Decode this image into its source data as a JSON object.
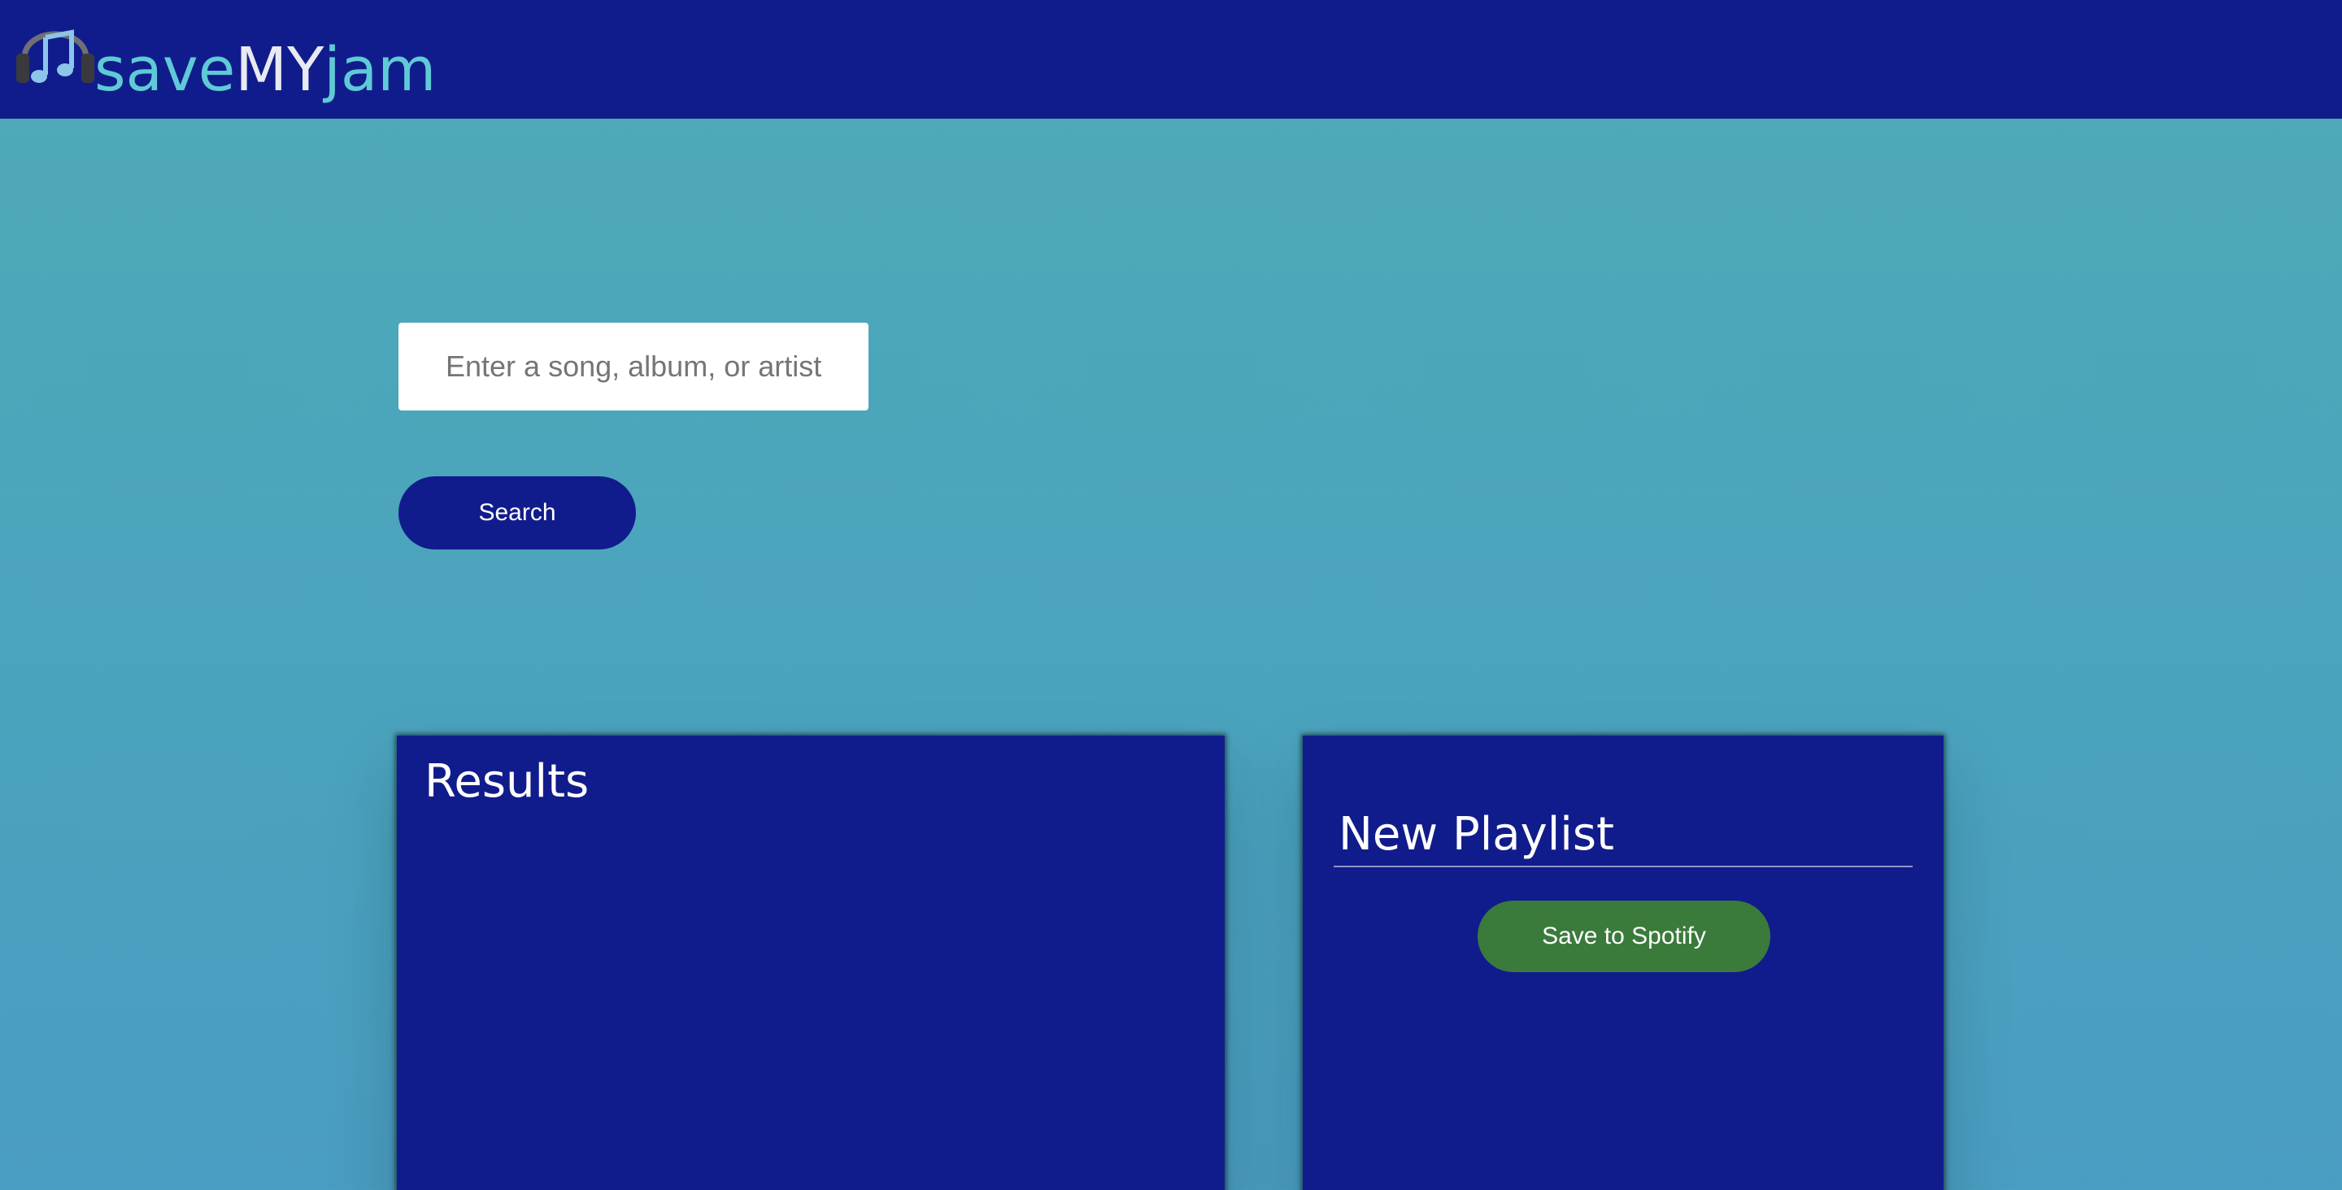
{
  "header": {
    "logo_icon": "headphones-music-note-icon",
    "brand": {
      "part1": "save",
      "part2": "MY",
      "part3": "jam"
    },
    "colors": {
      "background": "#111c8c",
      "brand_accent": "#5fcad6",
      "brand_mid": "#e8eaf2"
    }
  },
  "search": {
    "placeholder": "Enter a song, album, or artist",
    "value": "",
    "button_label": "Search"
  },
  "results": {
    "title": "Results",
    "items": []
  },
  "playlist": {
    "name": "New Playlist",
    "save_label": "Save to Spotify",
    "tracks": []
  },
  "colors": {
    "page_gradient_top": "#4faab7",
    "panel": "#111c8c",
    "save_button": "#3a7a3b"
  }
}
